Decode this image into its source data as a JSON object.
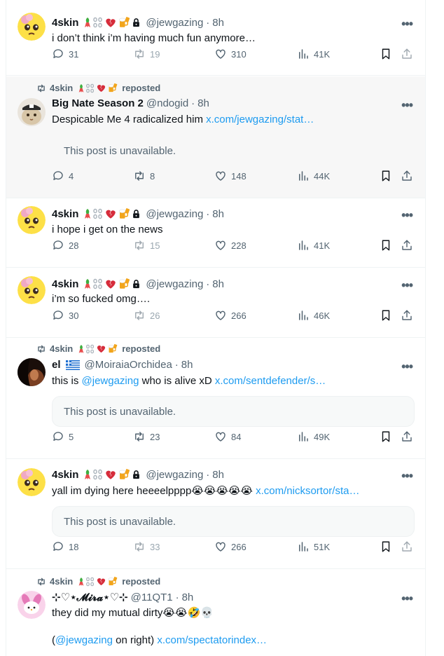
{
  "posts": [
    {
      "name": "4skin",
      "handle": "@jewgazing",
      "time": "8h",
      "text": "i don’t think i’m having much fun anymore…",
      "replies": "31",
      "reposts": "19",
      "likes": "310",
      "views": "41K"
    },
    {
      "context": "4skin",
      "context_suffix": "reposted",
      "name": "Big Nate Season 2",
      "handle": "@ndogid",
      "time": "8h",
      "text": "Despicable Me 4 radicalized him ",
      "link": "x.com/jewgazing/stat…",
      "quote": "This post is unavailable.",
      "replies": "4",
      "reposts": "8",
      "likes": "148",
      "views": "44K"
    },
    {
      "name": "4skin",
      "handle": "@jewgazing",
      "time": "8h",
      "text": "i hope i get on the news",
      "replies": "28",
      "reposts": "15",
      "likes": "228",
      "views": "41K"
    },
    {
      "name": "4skin",
      "handle": "@jewgazing",
      "time": "8h",
      "text": "i’m so fucked omg….",
      "replies": "30",
      "reposts": "26",
      "likes": "266",
      "views": "46K"
    },
    {
      "context": "4skin",
      "context_suffix": "reposted",
      "name": "el",
      "handle": "@MoiraiaOrchidea",
      "time": "8h",
      "text_pre": "this is ",
      "mention": "@jewgazing",
      "text_mid": " who is alive xD ",
      "link": "x.com/sentdefender/s…",
      "quote": "This post is unavailable.",
      "replies": "5",
      "reposts": "23",
      "likes": "84",
      "views": "49K"
    },
    {
      "name": "4skin",
      "handle": "@jewgazing",
      "time": "8h",
      "text": "yall im dying here heeeelpppp😭😭😭😭😭 ",
      "link": "x.com/nicksortor/sta…",
      "quote": "This post is unavailable.",
      "replies": "18",
      "reposts": "33",
      "likes": "266",
      "views": "51K"
    },
    {
      "context": "4skin",
      "context_suffix": "reposted",
      "name": "⊹♡⋆𝓜𝓲𝓻𝓪⋆♡⊹",
      "handle": "@11QT1",
      "time": "8h",
      "text": "they did my mutual dirty😭😭🤣💀",
      "text2_pre": "(",
      "mention": "@jewgazing",
      "text2_mid": " on right) ",
      "link": "x.com/spectatorindex…"
    }
  ],
  "dot": "·",
  "more": "•••",
  "colors": {
    "link": "#1d9bf0",
    "muted": "#536471",
    "text": "#0f1419",
    "highlight_bg": "#f7f7f7"
  }
}
